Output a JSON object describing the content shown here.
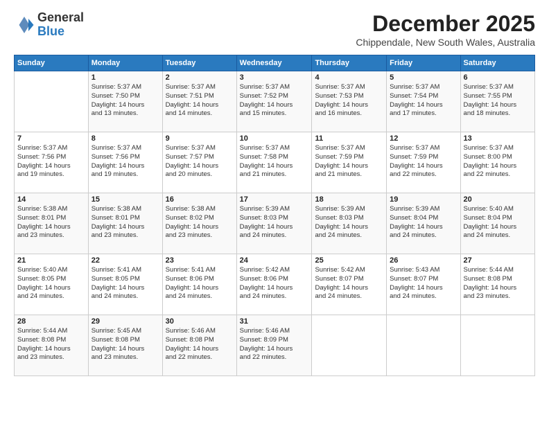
{
  "logo": {
    "general": "General",
    "blue": "Blue"
  },
  "header": {
    "month": "December 2025",
    "location": "Chippendale, New South Wales, Australia"
  },
  "weekdays": [
    "Sunday",
    "Monday",
    "Tuesday",
    "Wednesday",
    "Thursday",
    "Friday",
    "Saturday"
  ],
  "weeks": [
    [
      {
        "day": "",
        "info": ""
      },
      {
        "day": "1",
        "info": "Sunrise: 5:37 AM\nSunset: 7:50 PM\nDaylight: 14 hours\nand 13 minutes."
      },
      {
        "day": "2",
        "info": "Sunrise: 5:37 AM\nSunset: 7:51 PM\nDaylight: 14 hours\nand 14 minutes."
      },
      {
        "day": "3",
        "info": "Sunrise: 5:37 AM\nSunset: 7:52 PM\nDaylight: 14 hours\nand 15 minutes."
      },
      {
        "day": "4",
        "info": "Sunrise: 5:37 AM\nSunset: 7:53 PM\nDaylight: 14 hours\nand 16 minutes."
      },
      {
        "day": "5",
        "info": "Sunrise: 5:37 AM\nSunset: 7:54 PM\nDaylight: 14 hours\nand 17 minutes."
      },
      {
        "day": "6",
        "info": "Sunrise: 5:37 AM\nSunset: 7:55 PM\nDaylight: 14 hours\nand 18 minutes."
      }
    ],
    [
      {
        "day": "7",
        "info": "Sunrise: 5:37 AM\nSunset: 7:56 PM\nDaylight: 14 hours\nand 19 minutes."
      },
      {
        "day": "8",
        "info": "Sunrise: 5:37 AM\nSunset: 7:56 PM\nDaylight: 14 hours\nand 19 minutes."
      },
      {
        "day": "9",
        "info": "Sunrise: 5:37 AM\nSunset: 7:57 PM\nDaylight: 14 hours\nand 20 minutes."
      },
      {
        "day": "10",
        "info": "Sunrise: 5:37 AM\nSunset: 7:58 PM\nDaylight: 14 hours\nand 21 minutes."
      },
      {
        "day": "11",
        "info": "Sunrise: 5:37 AM\nSunset: 7:59 PM\nDaylight: 14 hours\nand 21 minutes."
      },
      {
        "day": "12",
        "info": "Sunrise: 5:37 AM\nSunset: 7:59 PM\nDaylight: 14 hours\nand 22 minutes."
      },
      {
        "day": "13",
        "info": "Sunrise: 5:37 AM\nSunset: 8:00 PM\nDaylight: 14 hours\nand 22 minutes."
      }
    ],
    [
      {
        "day": "14",
        "info": "Sunrise: 5:38 AM\nSunset: 8:01 PM\nDaylight: 14 hours\nand 23 minutes."
      },
      {
        "day": "15",
        "info": "Sunrise: 5:38 AM\nSunset: 8:01 PM\nDaylight: 14 hours\nand 23 minutes."
      },
      {
        "day": "16",
        "info": "Sunrise: 5:38 AM\nSunset: 8:02 PM\nDaylight: 14 hours\nand 23 minutes."
      },
      {
        "day": "17",
        "info": "Sunrise: 5:39 AM\nSunset: 8:03 PM\nDaylight: 14 hours\nand 24 minutes."
      },
      {
        "day": "18",
        "info": "Sunrise: 5:39 AM\nSunset: 8:03 PM\nDaylight: 14 hours\nand 24 minutes."
      },
      {
        "day": "19",
        "info": "Sunrise: 5:39 AM\nSunset: 8:04 PM\nDaylight: 14 hours\nand 24 minutes."
      },
      {
        "day": "20",
        "info": "Sunrise: 5:40 AM\nSunset: 8:04 PM\nDaylight: 14 hours\nand 24 minutes."
      }
    ],
    [
      {
        "day": "21",
        "info": "Sunrise: 5:40 AM\nSunset: 8:05 PM\nDaylight: 14 hours\nand 24 minutes."
      },
      {
        "day": "22",
        "info": "Sunrise: 5:41 AM\nSunset: 8:05 PM\nDaylight: 14 hours\nand 24 minutes."
      },
      {
        "day": "23",
        "info": "Sunrise: 5:41 AM\nSunset: 8:06 PM\nDaylight: 14 hours\nand 24 minutes."
      },
      {
        "day": "24",
        "info": "Sunrise: 5:42 AM\nSunset: 8:06 PM\nDaylight: 14 hours\nand 24 minutes."
      },
      {
        "day": "25",
        "info": "Sunrise: 5:42 AM\nSunset: 8:07 PM\nDaylight: 14 hours\nand 24 minutes."
      },
      {
        "day": "26",
        "info": "Sunrise: 5:43 AM\nSunset: 8:07 PM\nDaylight: 14 hours\nand 24 minutes."
      },
      {
        "day": "27",
        "info": "Sunrise: 5:44 AM\nSunset: 8:08 PM\nDaylight: 14 hours\nand 23 minutes."
      }
    ],
    [
      {
        "day": "28",
        "info": "Sunrise: 5:44 AM\nSunset: 8:08 PM\nDaylight: 14 hours\nand 23 minutes."
      },
      {
        "day": "29",
        "info": "Sunrise: 5:45 AM\nSunset: 8:08 PM\nDaylight: 14 hours\nand 23 minutes."
      },
      {
        "day": "30",
        "info": "Sunrise: 5:46 AM\nSunset: 8:08 PM\nDaylight: 14 hours\nand 22 minutes."
      },
      {
        "day": "31",
        "info": "Sunrise: 5:46 AM\nSunset: 8:09 PM\nDaylight: 14 hours\nand 22 minutes."
      },
      {
        "day": "",
        "info": ""
      },
      {
        "day": "",
        "info": ""
      },
      {
        "day": "",
        "info": ""
      }
    ]
  ]
}
